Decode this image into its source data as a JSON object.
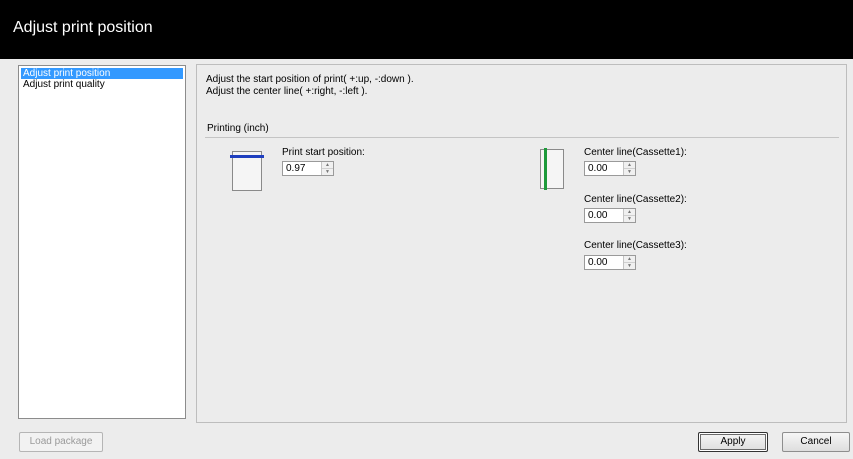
{
  "window": {
    "title": "Adjust print position"
  },
  "sidebar": {
    "items": [
      {
        "label": "Adjust print position",
        "selected": true
      },
      {
        "label": "Adjust print quality",
        "selected": false
      }
    ]
  },
  "main": {
    "description_line1": "Adjust the start position of print( +:up, -:down ).",
    "description_line2": "Adjust the center line( +:right, -:left ).",
    "section_label": "Printing (inch)",
    "print_start": {
      "label": "Print start position:",
      "value": "0.97"
    },
    "center_lines": [
      {
        "label": "Center line(Cassette1):",
        "value": "0.00"
      },
      {
        "label": "Center line(Cassette2):",
        "value": "0.00"
      },
      {
        "label": "Center line(Cassette3):",
        "value": "0.00"
      }
    ],
    "icons": {
      "print_start_icon": "paper-top-edge-icon",
      "center_line_icon": "paper-center-line-icon",
      "spin_up": "▲",
      "spin_down": "▼"
    },
    "colors": {
      "top_edge_line": "#1f3fbf",
      "center_line": "#1d9a3a",
      "selection": "#3399ff"
    }
  },
  "footer": {
    "load_package_label": "Load package",
    "apply_label": "Apply",
    "cancel_label": "Cancel"
  }
}
